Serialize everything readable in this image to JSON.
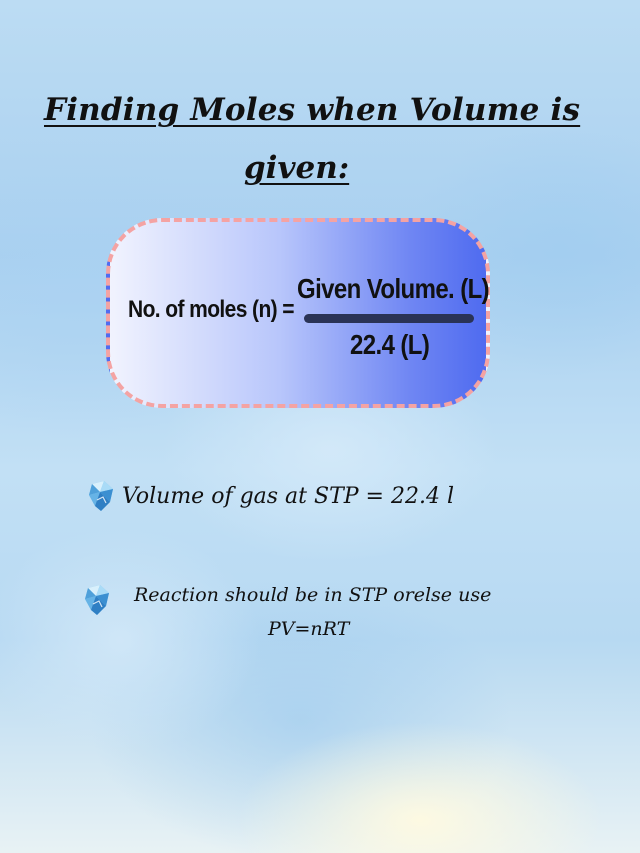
{
  "title": {
    "line1": "Finding Moles when Volume is",
    "line2": "given:"
  },
  "formula": {
    "lhs": "No. of moles (n) =",
    "numerator": "Given Volume. (L)",
    "denominator": "22.4 (L)"
  },
  "notes": [
    {
      "icon": "crystal-icon",
      "text": "Volume of gas at STP = 22.4 l"
    },
    {
      "icon": "crystal-icon",
      "text_line1": "Reaction should be in STP orelse use",
      "text_line2": "PV=nRT"
    }
  ],
  "colors": {
    "background": "#b7d9f2",
    "card_border": "#f4a3a3",
    "card_gradient_start": "#f1f3fe",
    "card_gradient_end": "#4f6bf0",
    "fraction_bar": "#2a3356",
    "text": "#111111"
  }
}
